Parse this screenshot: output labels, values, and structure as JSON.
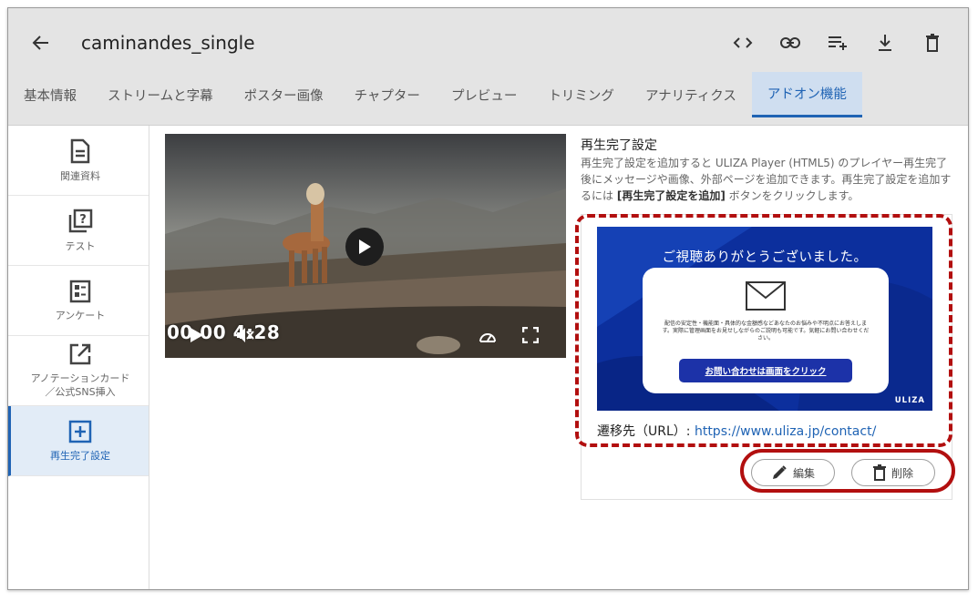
{
  "header": {
    "title": "caminandes_single",
    "back_icon": "arrow-left-icon",
    "action_icons": [
      "code-icon",
      "link-icon",
      "playlist-add-icon",
      "download-icon",
      "trash-icon"
    ]
  },
  "tabs": [
    {
      "label": "基本情報",
      "active": false
    },
    {
      "label": "ストリームと字幕",
      "active": false
    },
    {
      "label": "ポスター画像",
      "active": false
    },
    {
      "label": "チャプター",
      "active": false
    },
    {
      "label": "プレビュー",
      "active": false
    },
    {
      "label": "トリミング",
      "active": false
    },
    {
      "label": "アナリティクス",
      "active": false
    },
    {
      "label": "アドオン機能",
      "active": true
    }
  ],
  "sidebar": {
    "items": [
      {
        "label": "関連資料",
        "icon": "document-icon"
      },
      {
        "label": "テスト",
        "icon": "quiz-icon"
      },
      {
        "label": "アンケート",
        "icon": "survey-icon"
      },
      {
        "label": "アノテーションカード\n／公式SNS挿入",
        "icon": "external-link-icon"
      },
      {
        "label": "再生完了設定",
        "icon": "add-box-icon",
        "active": true
      }
    ]
  },
  "video": {
    "time": "00:00:04:28",
    "time_display": "00 00 4:28"
  },
  "playback_complete": {
    "title": "再生完了設定",
    "description_1": "再生完了設定を追加すると ULIZA Player (HTML5) のプレイヤー再生完了後にメッセージや画像、外部ページを追加できます。再生完了設定を追加するには ",
    "description_bold": "[再生完了設定を追加]",
    "description_2": " ボタンをクリックします。",
    "banner": {
      "heading": "ご視聴ありがとうございました。",
      "body": "配信の安定性・機能面・具体的な金額感などあなたのお悩みや不明点にお答えします。実際に管理画面をお見せしながらのご説明も可能です。気軽にお問い合わせください。",
      "button": "お問い合わせは画面をクリック",
      "logo": "ULIZA"
    },
    "destination_label": "遷移先（URL）: ",
    "destination_url": "https://www.uliza.jp/contact/",
    "edit_label": "編集",
    "delete_label": "削除"
  },
  "colors": {
    "accent": "#1f63b4",
    "annotation": "#b20f0f",
    "banner": "#1136a4"
  }
}
